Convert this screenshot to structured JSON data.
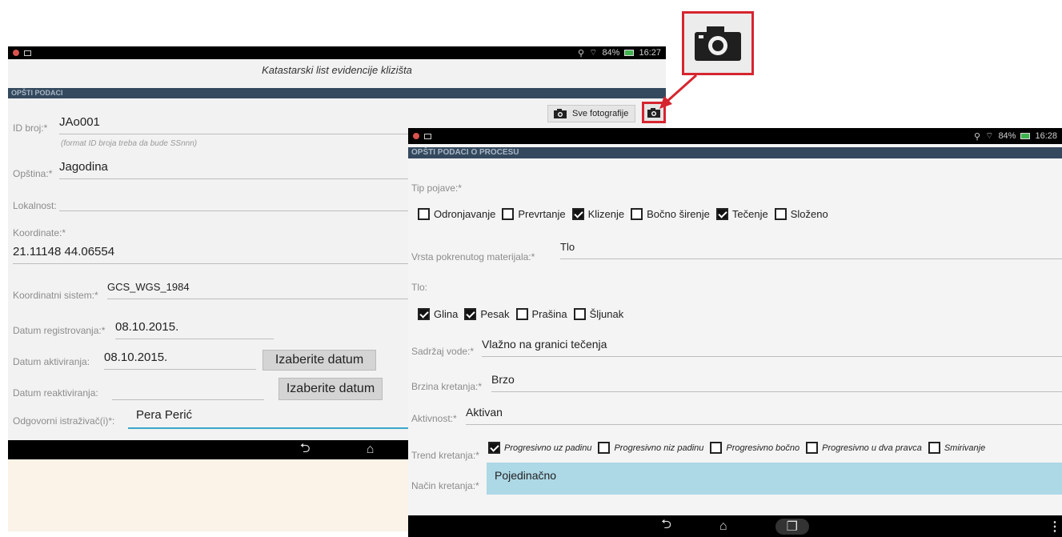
{
  "screen1": {
    "status": {
      "battery": "84%",
      "time": "16:27"
    },
    "title": "Katastarski list evidencije klizišta",
    "section": "OPŠTI PODACI",
    "all_photos_label": "Sve fotografije",
    "fields": {
      "id_label": "ID broj:*",
      "id_value": "JAo001",
      "id_hint": "(format ID broja treba da bude SSnnn)",
      "opstina_label": "Opština:*",
      "opstina_value": "Jagodina",
      "lokalnost_label": "Lokalnost:",
      "koordinate_label": "Koordinate:*",
      "koordinate_value": "21.11148 44.06554",
      "sistem_label": "Koordinatni sistem:*",
      "sistem_value": "GCS_WGS_1984",
      "reg_label": "Datum registrovanja:*",
      "reg_value": "08.10.2015.",
      "akt_label": "Datum aktiviranja:",
      "akt_value": "08.10.2015.",
      "reakt_label": "Datum reaktiviranja:",
      "istr_label": "Odgovorni istraživač(i)*:",
      "istr_value": "Pera Perić"
    },
    "choose_date_label": "Izaberite datum"
  },
  "screen2": {
    "status": {
      "battery": "84%",
      "time": "16:28"
    },
    "section": "OPŠTI PODACI O PROCESU",
    "tip_label": "Tip pojave:*",
    "tip_options": [
      {
        "label": "Odronjavanje",
        "checked": false
      },
      {
        "label": "Prevrtanje",
        "checked": false
      },
      {
        "label": "Klizenje",
        "checked": true
      },
      {
        "label": "Bočno širenje",
        "checked": false
      },
      {
        "label": "Tečenje",
        "checked": true
      },
      {
        "label": "Složeno",
        "checked": false
      }
    ],
    "vrsta_label": "Vrsta pokrenutog materijala:*",
    "vrsta_value": "Tlo",
    "tlo_label": "Tlo:",
    "tlo_options": [
      {
        "label": "Glina",
        "checked": true
      },
      {
        "label": "Pesak",
        "checked": true
      },
      {
        "label": "Prašina",
        "checked": false
      },
      {
        "label": "Šljunak",
        "checked": false
      }
    ],
    "voda_label": "Sadržaj vode:*",
    "voda_value": "Vlažno na granici tečenja",
    "brzina_label": "Brzina kretanja:*",
    "brzina_value": "Brzo",
    "aktivnost_label": "Aktivnost:*",
    "aktivnost_value": "Aktivan",
    "trend_label": "Trend kretanja:*",
    "trend_options": [
      {
        "label": "Progresivno uz padinu",
        "checked": true
      },
      {
        "label": "Progresivno niz padinu",
        "checked": false
      },
      {
        "label": "Progresivno bočno",
        "checked": false
      },
      {
        "label": "Progresivno u dva pravca",
        "checked": false
      },
      {
        "label": "Smirivanje",
        "checked": false
      }
    ],
    "nacin_label": "Način kretanja:*",
    "nacin_value": "Pojedinačno"
  },
  "colors": {
    "highlight": "#d6252f",
    "section_bar": "#34495e",
    "selected_field": "#add8e6"
  }
}
